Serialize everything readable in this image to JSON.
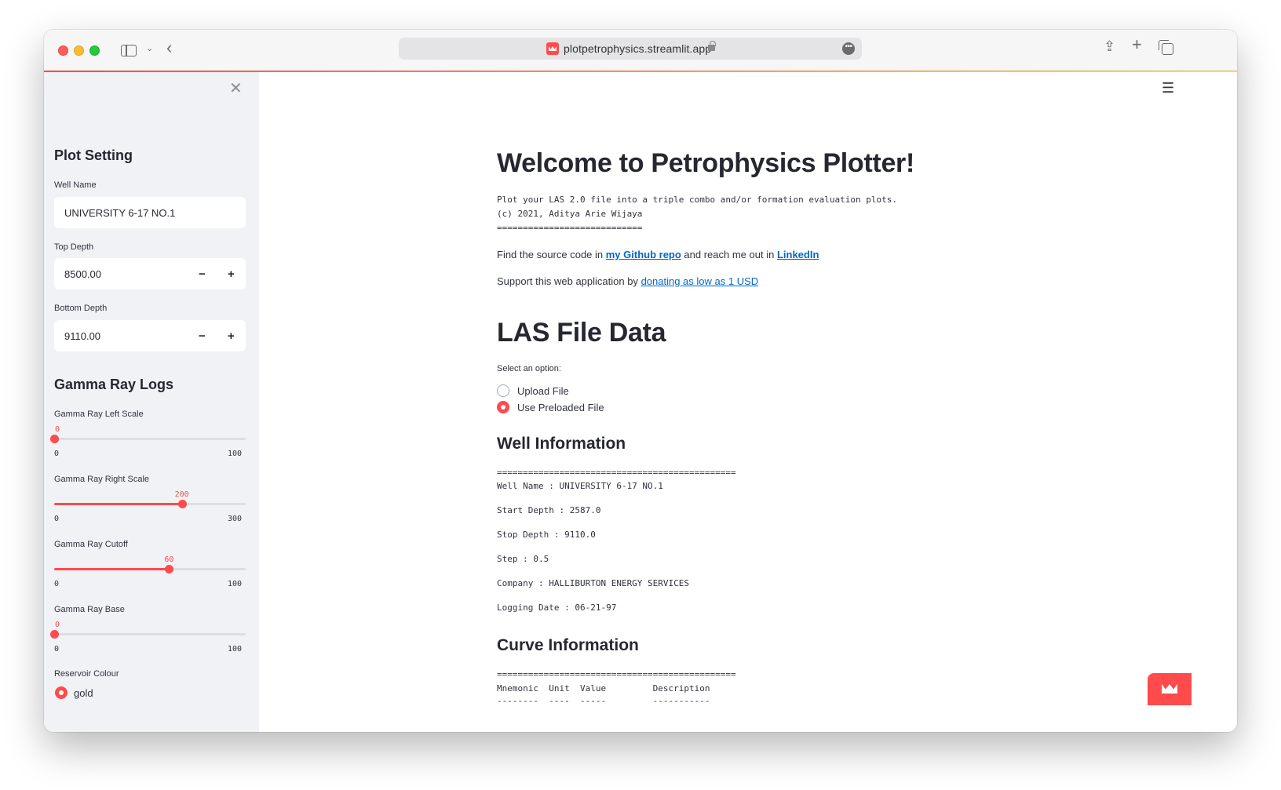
{
  "browser": {
    "url": "plotpetrophysics.streamlit.app"
  },
  "sidebar": {
    "section_plot": "Plot Setting",
    "well_name_label": "Well Name",
    "well_name_value": "UNIVERSITY 6-17 NO.1",
    "top_depth_label": "Top Depth",
    "top_depth_value": "8500.00",
    "bottom_depth_label": "Bottom Depth",
    "bottom_depth_value": "9110.00",
    "minus": "−",
    "plus": "+",
    "section_gamma": "Gamma Ray Logs",
    "sliders": [
      {
        "label": "Gamma Ray Left Scale",
        "value": "0",
        "min": "0",
        "max": "100",
        "fraction": 0.0
      },
      {
        "label": "Gamma Ray Right Scale",
        "value": "200",
        "min": "0",
        "max": "300",
        "fraction": 0.6667
      },
      {
        "label": "Gamma Ray Cutoff",
        "value": "60",
        "min": "0",
        "max": "100",
        "fraction": 0.6
      },
      {
        "label": "Gamma Ray Base",
        "value": "0",
        "min": "0",
        "max": "100",
        "fraction": 0.0
      }
    ],
    "reservoir_colour_label": "Reservoir Colour",
    "reservoir_colour_selected": "gold"
  },
  "main": {
    "title": "Welcome to Petrophysics Plotter!",
    "intro_line1": "Plot your LAS 2.0 file into a triple combo and/or formation evaluation plots.",
    "intro_line2": "(c) 2021, Aditya Arie Wijaya",
    "intro_rule": "============================",
    "source_pre": "Find the source code in ",
    "source_link": "my Github repo",
    "source_mid": " and reach me out in ",
    "linkedin_link": "LinkedIn",
    "support_pre": "Support this web application by ",
    "support_link": "donating as low as 1 USD",
    "las_title": "LAS File Data",
    "select_label": "Select an option:",
    "option_upload": "Upload File",
    "option_preloaded": "Use Preloaded File",
    "well_info_title": "Well Information",
    "well_info_rule": "==============================================",
    "well_info": [
      "Well Name : UNIVERSITY 6-17 NO.1",
      "Start Depth : 2587.0",
      "Stop Depth : 9110.0",
      "Step : 0.5",
      "Company : HALLIBURTON ENERGY SERVICES",
      "Logging Date : 06-21-97"
    ],
    "curve_info_title": "Curve Information",
    "curve_info_rule": "==============================================",
    "curve_header": "Mnemonic  Unit  Value         Description",
    "curve_header_rule": "--------  ----  -----         -----------"
  },
  "colors": {
    "accent": "#ff4b4b",
    "link": "#0068c9",
    "sidebar_bg": "#f0f2f6"
  }
}
